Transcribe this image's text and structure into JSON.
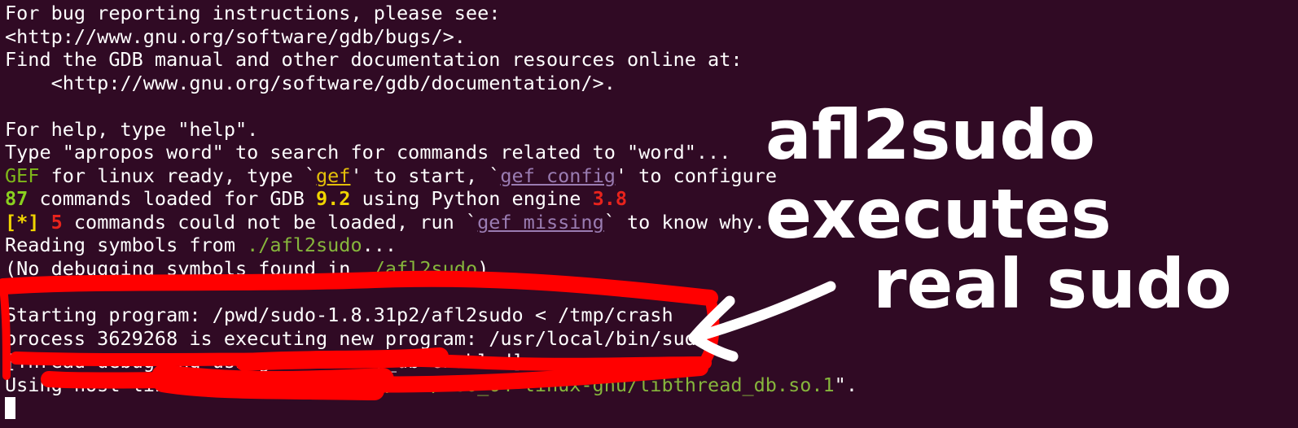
{
  "terminal": {
    "line1": "For bug reporting instructions, please see:",
    "line2": "<http://www.gnu.org/software/gdb/bugs/>.",
    "line3": "Find the GDB manual and other documentation resources online at:",
    "line4": "    <http://www.gnu.org/software/gdb/documentation/>.",
    "line5": "For help, type \"help\".",
    "line6": "Type \"apropos word\" to search for commands related to \"word\"...",
    "gef": {
      "gef_label": "GEF",
      "text_a": " for linux ready, type `",
      "gef_cmd": "gef",
      "text_b": "' to start, `",
      "gef_config": "gef config",
      "text_c": "' to configure"
    },
    "loaded": {
      "count": "87",
      "text_a": " commands loaded for GDB ",
      "gdb_version": "9.2",
      "text_b": " using Python engine ",
      "python_version": "3.8"
    },
    "missing": {
      "marker": "[*]",
      "count": " 5",
      "text_a": " commands could not be loaded, run `",
      "cmd": "gef missing",
      "text_b": "` to know why."
    },
    "reading": {
      "text_a": "Reading symbols from ",
      "path": "./afl2sudo",
      "text_b": "..."
    },
    "nodebug": {
      "text_a": "(No debugging symbols found in ",
      "path": "./afl2sudo",
      "text_b": ")"
    },
    "starting": "Starting program: /pwd/sudo-1.8.31p2/afl2sudo < /tmp/crash",
    "process": "process 3629268 is executing new program: /usr/local/bin/sudo",
    "thread_debug": "[Thread debugging using libthread_db enabled]",
    "using_host": {
      "text_a": "Using host libthread_db library \"",
      "path": "/lib/x86_64-linux-gnu/libthread_db.so.1",
      "text_b": "\"."
    }
  },
  "annotation": {
    "line1": "afl2sudo",
    "line2": "executes",
    "line3": "real sudo",
    "color": "#ffffff",
    "scribble_color": "#ff0000"
  }
}
